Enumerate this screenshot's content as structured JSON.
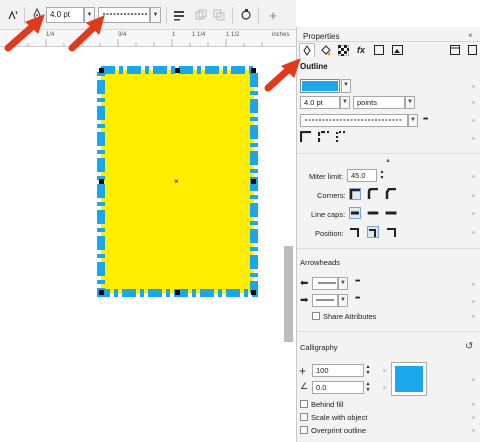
{
  "toolbar": {
    "width_value": "4.0 pt",
    "add_label": "+"
  },
  "ruler": {
    "labels": [
      "1/4",
      "3/4",
      "1",
      "1 1/4",
      "1 1/2",
      "inches"
    ]
  },
  "panel": {
    "title": "Properties",
    "tabs": [
      "outline-pen",
      "fill",
      "transparency",
      "effects",
      "frame",
      "image"
    ],
    "outline_title": "Outline",
    "outline_color": "#1aa7ec",
    "width_value": "4.0 pt",
    "width_unit": "points",
    "more_label": "•••",
    "miter_label": "Miter limit:",
    "miter_value": "45.0",
    "corners_label": "Corners:",
    "linecaps_label": "Line caps:",
    "position_label": "Position:",
    "arrowheads_title": "Arrowheads",
    "share_attr_label": "Share Attributes",
    "calligraphy_title": "Calligraphy",
    "stretch_value": "100",
    "angle_value": "0.0",
    "calligraphy_color": "#1aa7ec",
    "behind_fill_label": "Behind fill",
    "scale_label": "Scale with object",
    "overprint_label": "Overprint outline"
  },
  "colors": {
    "fill": "#ffee00",
    "outline": "#1aa7ec",
    "annotation_arrow": "#e03a1c"
  }
}
